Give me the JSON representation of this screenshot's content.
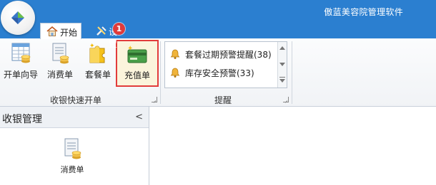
{
  "app": {
    "title": "傲蓝美容院管理软件"
  },
  "tabs": [
    {
      "label": "开始",
      "active": true
    },
    {
      "label": "设置",
      "active": false
    }
  ],
  "badge": {
    "count": "1",
    "color": "#e03b3b"
  },
  "ribbon": {
    "cashier_group": {
      "label": "收银快速开单",
      "buttons": [
        {
          "label": "开单向导",
          "icon": "wizard-table-icon"
        },
        {
          "label": "消费单",
          "icon": "consumption-receipt-icon"
        },
        {
          "label": "套餐单",
          "icon": "puzzle-package-icon"
        },
        {
          "label": "充值单",
          "icon": "recharge-card-icon",
          "highlighted": true
        }
      ]
    },
    "reminder_group": {
      "label": "提醒",
      "items": [
        {
          "label": "套餐过期预警提醒(38)",
          "icon": "bell-icon"
        },
        {
          "label": "库存安全预警(33)",
          "icon": "bell-icon"
        }
      ]
    }
  },
  "sidebar": {
    "title": "收银管理",
    "items": [
      {
        "label": "消费单",
        "icon": "consumption-receipt-icon"
      }
    ]
  },
  "colors": {
    "accent": "#2b7fd0",
    "highlight_border": "#e23b3b"
  }
}
